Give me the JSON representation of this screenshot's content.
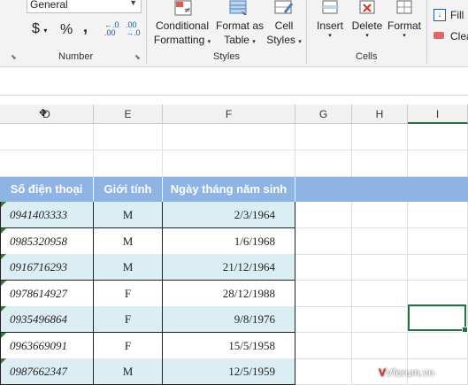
{
  "ribbon": {
    "number_format": "General",
    "currency_symbol": "$",
    "percent_symbol": "%",
    "comma_symbol": ",",
    "inc_decimal": ".00",
    "dec_decimal": ".00",
    "number_group_label": "Number",
    "conditional_line1": "Conditional",
    "conditional_line2": "Formatting",
    "format_table_line1": "Format as",
    "format_table_line2": "Table",
    "cell_styles_line1": "Cell",
    "cell_styles_line2": "Styles",
    "styles_group_label": "Styles",
    "insert_label": "Insert",
    "delete_label": "Delete",
    "format_label": "Format",
    "cells_group_label": "Cells",
    "fill_label": "Fill",
    "clear_label": "Clea"
  },
  "columns": [
    "D",
    "E",
    "F",
    "G",
    "H",
    "I"
  ],
  "table": {
    "headers": [
      "Số điện thoại",
      "Giới tính",
      "Ngày tháng năm sinh"
    ],
    "rows": [
      [
        "0941403333",
        "M",
        "2/3/1964"
      ],
      [
        "0985320958",
        "M",
        "1/6/1968"
      ],
      [
        "0916716293",
        "M",
        "21/12/1964"
      ],
      [
        "0978614927",
        "F",
        "28/12/1988"
      ],
      [
        "0935496864",
        "F",
        "9/8/1976"
      ],
      [
        "0963669091",
        "F",
        "15/5/1958"
      ],
      [
        "0987662347",
        "M",
        "12/5/1959"
      ]
    ]
  },
  "colors": {
    "header_bg": "#8eb4e3",
    "band_row": "#dbeef3",
    "selection": "#217346"
  },
  "watermark": "Vforum.vn"
}
